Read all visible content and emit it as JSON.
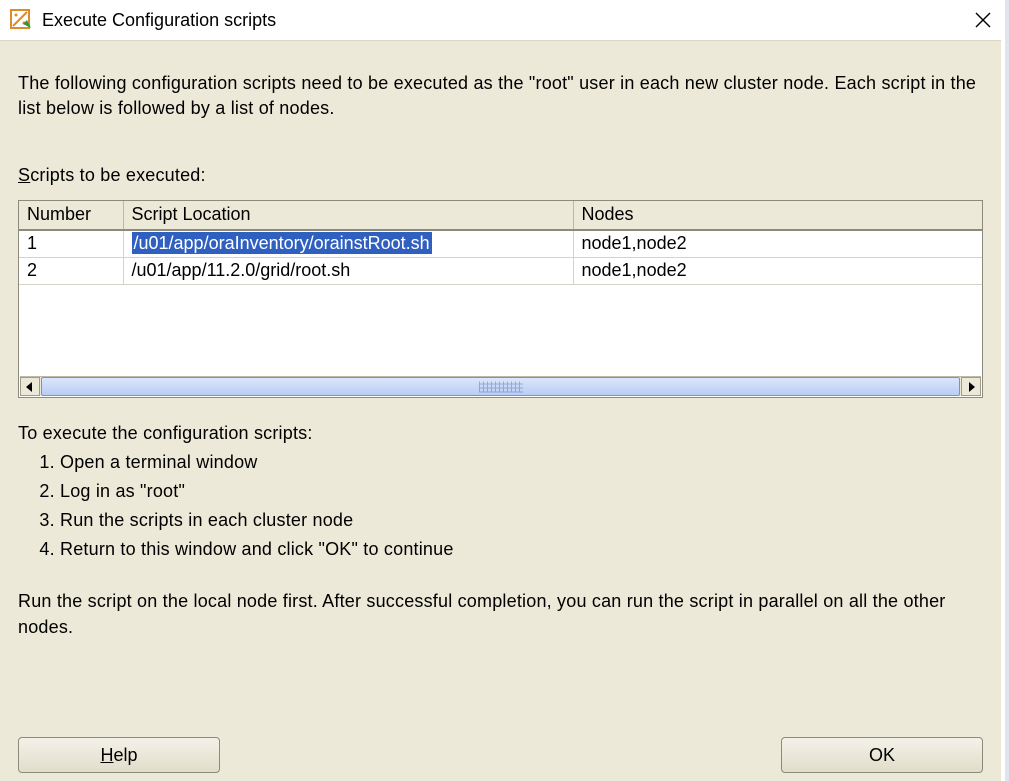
{
  "window": {
    "title": "Execute Configuration scripts"
  },
  "intro": "The following configuration scripts need to be executed as the \"root\" user in each new cluster node. Each script in the list below is followed by a list of nodes.",
  "scripts_label_prefix": "S",
  "scripts_label_rest": "cripts to be executed:",
  "table": {
    "headers": {
      "number": "Number",
      "location": "Script Location",
      "nodes": "Nodes"
    },
    "rows": [
      {
        "number": "1",
        "location": "/u01/app/oraInventory/orainstRoot.sh",
        "nodes": "node1,node2",
        "selected": true
      },
      {
        "number": "2",
        "location": "/u01/app/11.2.0/grid/root.sh",
        "nodes": "node1,node2",
        "selected": false
      }
    ]
  },
  "instructions": {
    "lead": "To execute the configuration scripts:",
    "steps": [
      "Open a terminal window",
      "Log in as \"root\"",
      "Run the scripts in each cluster node",
      "Return to this window and click \"OK\" to continue"
    ]
  },
  "footer_note": "Run the script on the local node first. After successful completion, you can run the script in parallel on all the other nodes.",
  "buttons": {
    "help_prefix": "H",
    "help_rest": "elp",
    "ok": "OK"
  }
}
